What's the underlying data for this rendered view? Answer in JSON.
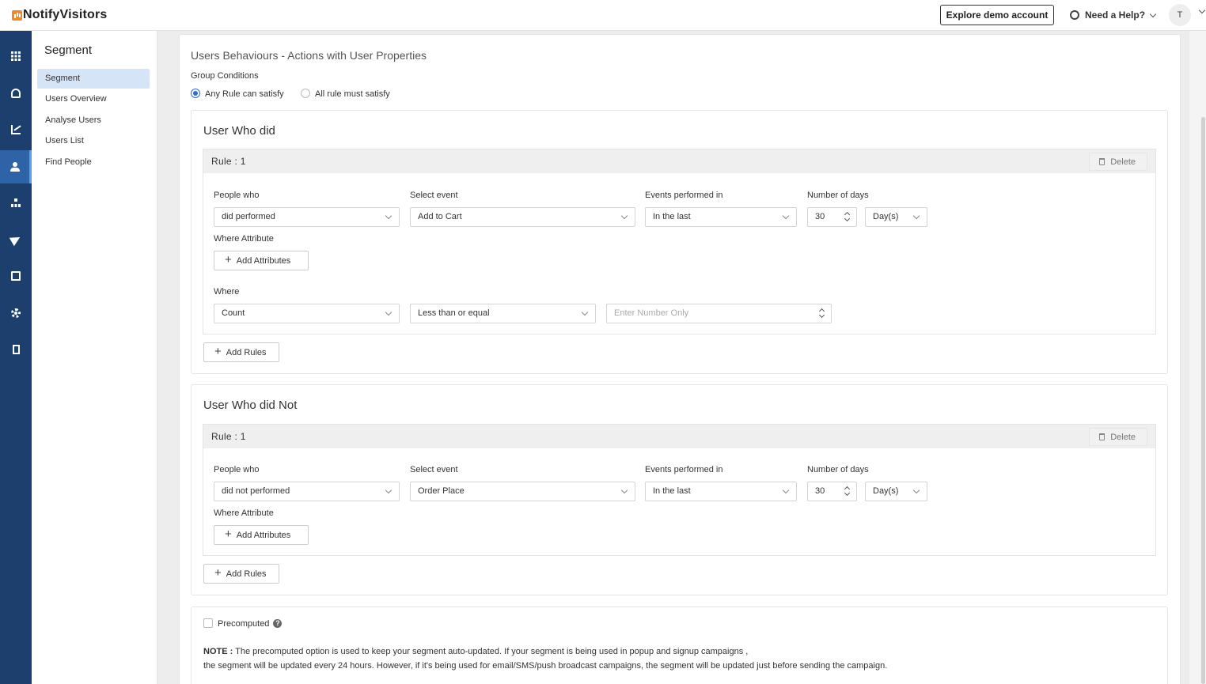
{
  "app": {
    "logo_text": "NotifyVisitors"
  },
  "header": {
    "explore_label": "Explore demo account",
    "help_label": "Need a Help?",
    "avatar_initial": "T"
  },
  "rail": {
    "icons": [
      "grid-icon",
      "dashboard-icon",
      "analytics-icon",
      "users-icon",
      "hierarchy-icon",
      "send-icon",
      "image-icon",
      "gear-icon",
      "building-icon"
    ],
    "active_index": 3
  },
  "subnav": {
    "title": "Segment",
    "items": [
      "Segment",
      "Users Overview",
      "Analyse Users",
      "Users List",
      "Find People"
    ],
    "active_index": 0
  },
  "main": {
    "title": "Users Behaviours - Actions with User Properties",
    "group_conditions_label": "Group Conditions",
    "radio_any": "Any Rule can satisfy",
    "radio_all": "All rule must satisfy",
    "selected_radio": "any"
  },
  "did_section": {
    "title": "User Who did",
    "rule_title": "Rule : 1",
    "delete_label": "Delete",
    "people_who_label": "People who",
    "people_who_value": "did performed",
    "select_event_label": "Select event",
    "select_event_value": "Add to Cart",
    "events_performed_label": "Events performed in",
    "events_performed_value": "In the last",
    "number_days_label": "Number of days",
    "number_days_value": "30",
    "unit_value": "Day(s)",
    "where_attribute_label": "Where Attribute",
    "add_attributes_label": "Add Attributes",
    "where_label": "Where",
    "where_field_value": "Count",
    "where_operator_value": "Less than or equal",
    "where_number_placeholder": "Enter Number Only",
    "add_rules_label": "Add Rules"
  },
  "did_not_section": {
    "title": "User Who did Not",
    "rule_title": "Rule : 1",
    "delete_label": "Delete",
    "people_who_label": "People who",
    "people_who_value": "did not performed",
    "select_event_label": "Select event",
    "select_event_value": "Order Place",
    "events_performed_label": "Events performed in",
    "events_performed_value": "In the last",
    "number_days_label": "Number of days",
    "number_days_value": "30",
    "unit_value": "Day(s)",
    "where_attribute_label": "Where Attribute",
    "add_attributes_label": "Add Attributes",
    "add_rules_label": "Add Rules"
  },
  "precomputed": {
    "label": "Precomputed",
    "checked": false,
    "help_glyph": "?",
    "note_prefix": "NOTE :",
    "note_line1": " The precomputed option is used to keep your segment auto-updated. If your segment is being used in popup and signup campaigns ,",
    "note_line2": "the segment will be updated every 24 hours. However, if it's being used for email/SMS/push broadcast campaigns, the segment will be updated just before sending the campaign."
  }
}
